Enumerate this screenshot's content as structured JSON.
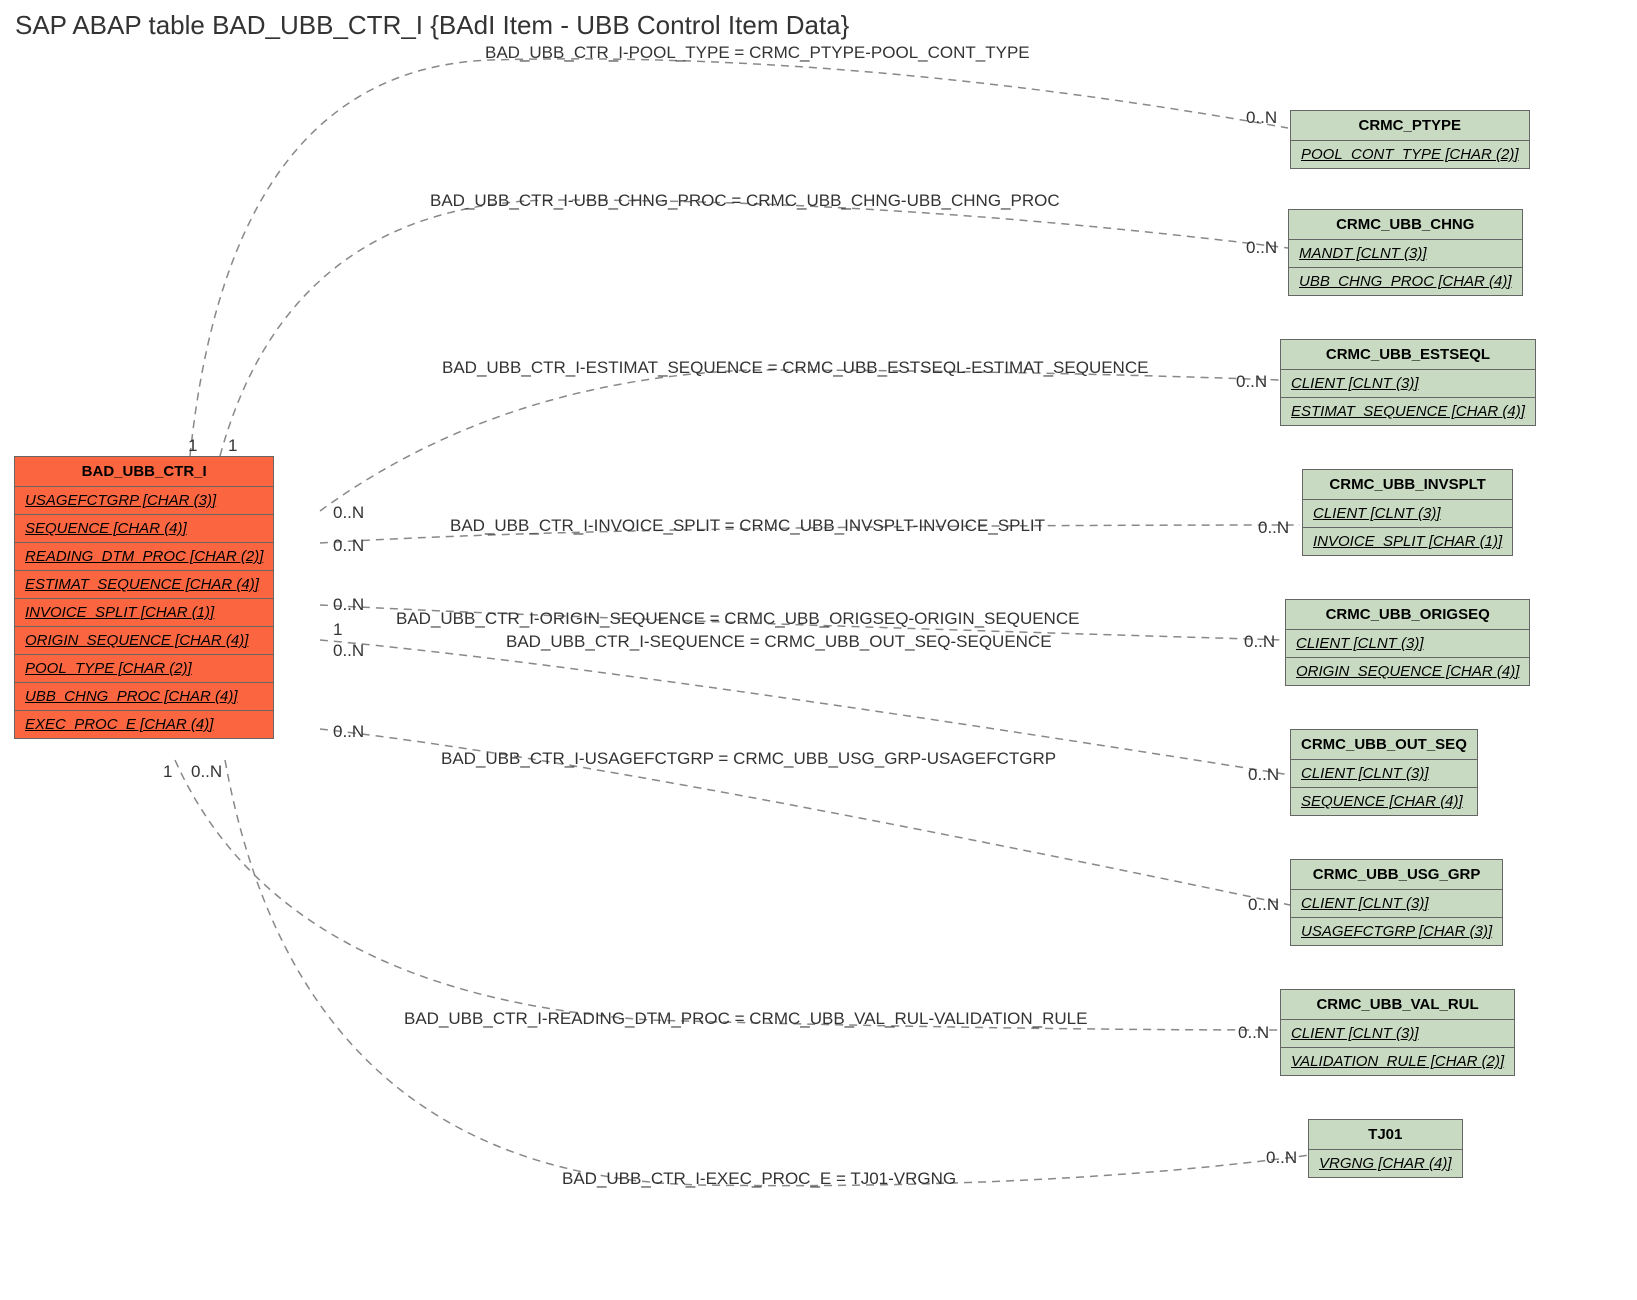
{
  "title": "SAP ABAP table BAD_UBB_CTR_I {BAdI Item - UBB Control Item Data}",
  "main": {
    "name": "BAD_UBB_CTR_I",
    "fields": [
      "USAGEFCTGRP [CHAR (3)]",
      "SEQUENCE [CHAR (4)]",
      "READING_DTM_PROC [CHAR (2)]",
      "ESTIMAT_SEQUENCE [CHAR (4)]",
      "INVOICE_SPLIT [CHAR (1)]",
      "ORIGIN_SEQUENCE [CHAR (4)]",
      "POOL_TYPE [CHAR (2)]",
      "UBB_CHNG_PROC [CHAR (4)]",
      "EXEC_PROC_E [CHAR (4)]"
    ]
  },
  "refs": [
    {
      "name": "CRMC_PTYPE",
      "fields": [
        "POOL_CONT_TYPE [CHAR (2)]"
      ]
    },
    {
      "name": "CRMC_UBB_CHNG",
      "fields": [
        "MANDT [CLNT (3)]",
        "UBB_CHNG_PROC [CHAR (4)]"
      ]
    },
    {
      "name": "CRMC_UBB_ESTSEQL",
      "fields": [
        "CLIENT [CLNT (3)]",
        "ESTIMAT_SEQUENCE [CHAR (4)]"
      ]
    },
    {
      "name": "CRMC_UBB_INVSPLT",
      "fields": [
        "CLIENT [CLNT (3)]",
        "INVOICE_SPLIT [CHAR (1)]"
      ]
    },
    {
      "name": "CRMC_UBB_ORIGSEQ",
      "fields": [
        "CLIENT [CLNT (3)]",
        "ORIGIN_SEQUENCE [CHAR (4)]"
      ]
    },
    {
      "name": "CRMC_UBB_OUT_SEQ",
      "fields": [
        "CLIENT [CLNT (3)]",
        "SEQUENCE [CHAR (4)]"
      ]
    },
    {
      "name": "CRMC_UBB_USG_GRP",
      "fields": [
        "CLIENT [CLNT (3)]",
        "USAGEFCTGRP [CHAR (3)]"
      ]
    },
    {
      "name": "CRMC_UBB_VAL_RUL",
      "fields": [
        "CLIENT [CLNT (3)]",
        "VALIDATION_RULE [CHAR (2)]"
      ]
    },
    {
      "name": "TJ01",
      "fields": [
        "VRGNG [CHAR (4)]"
      ]
    }
  ],
  "relations": [
    "BAD_UBB_CTR_I-POOL_TYPE = CRMC_PTYPE-POOL_CONT_TYPE",
    "BAD_UBB_CTR_I-UBB_CHNG_PROC = CRMC_UBB_CHNG-UBB_CHNG_PROC",
    "BAD_UBB_CTR_I-ESTIMAT_SEQUENCE = CRMC_UBB_ESTSEQL-ESTIMAT_SEQUENCE",
    "BAD_UBB_CTR_I-INVOICE_SPLIT = CRMC_UBB_INVSPLT-INVOICE_SPLIT",
    "BAD_UBB_CTR_I-ORIGIN_SEQUENCE = CRMC_UBB_ORIGSEQ-ORIGIN_SEQUENCE",
    "BAD_UBB_CTR_I-SEQUENCE = CRMC_UBB_OUT_SEQ-SEQUENCE",
    "BAD_UBB_CTR_I-USAGEFCTGRP = CRMC_UBB_USG_GRP-USAGEFCTGRP",
    "BAD_UBB_CTR_I-READING_DTM_PROC = CRMC_UBB_VAL_RUL-VALIDATION_RULE",
    "BAD_UBB_CTR_I-EXEC_PROC_E = TJ01-VRGNG"
  ],
  "cards": {
    "n": "0..N",
    "one": "1"
  }
}
